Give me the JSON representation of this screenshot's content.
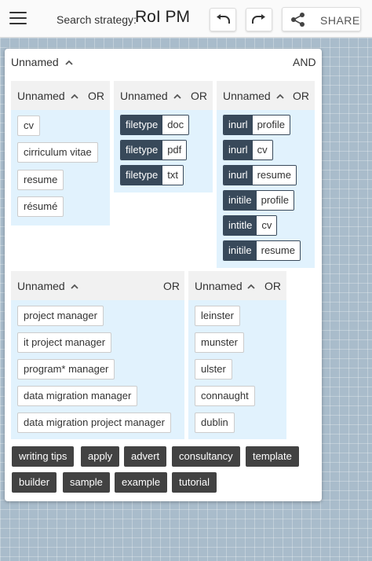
{
  "header": {
    "search_label": "Search strategy:",
    "search_value": "RoI PM",
    "share_label": "SHARE"
  },
  "root": {
    "title": "Unnamed",
    "operator": "AND"
  },
  "groups": {
    "g1": {
      "title": "Unnamed",
      "operator": "OR",
      "terms": [
        "cv",
        "cirriculum vitae",
        "resume",
        "résumé"
      ]
    },
    "g2": {
      "title": "Unnamed",
      "operator": "OR",
      "pairs": [
        {
          "key": "filetype",
          "value": "doc"
        },
        {
          "key": "filetype",
          "value": "pdf"
        },
        {
          "key": "filetype",
          "value": "txt"
        }
      ]
    },
    "g3": {
      "title": "Unnamed",
      "operator": "OR",
      "pairs": [
        {
          "key": "inurl",
          "value": "profile"
        },
        {
          "key": "inurl",
          "value": "cv"
        },
        {
          "key": "inurl",
          "value": "resume"
        },
        {
          "key": "initile",
          "value": "profile"
        },
        {
          "key": "intitle",
          "value": "cv"
        },
        {
          "key": "initile",
          "value": "resume"
        }
      ]
    },
    "g4": {
      "title": "Unnamed",
      "operator": "OR",
      "terms": [
        "project manager",
        "it project manager",
        "program* manager",
        "data migration manager",
        "data migration project manager"
      ]
    },
    "g5": {
      "title": "Unnamed",
      "operator": "OR",
      "terms": [
        "leinster",
        "munster",
        "ulster",
        "connaught",
        "dublin"
      ]
    }
  },
  "tags": [
    "writing tips",
    "apply",
    "advert",
    "consultancy",
    "template",
    "builder",
    "sample",
    "example",
    "tutorial"
  ]
}
